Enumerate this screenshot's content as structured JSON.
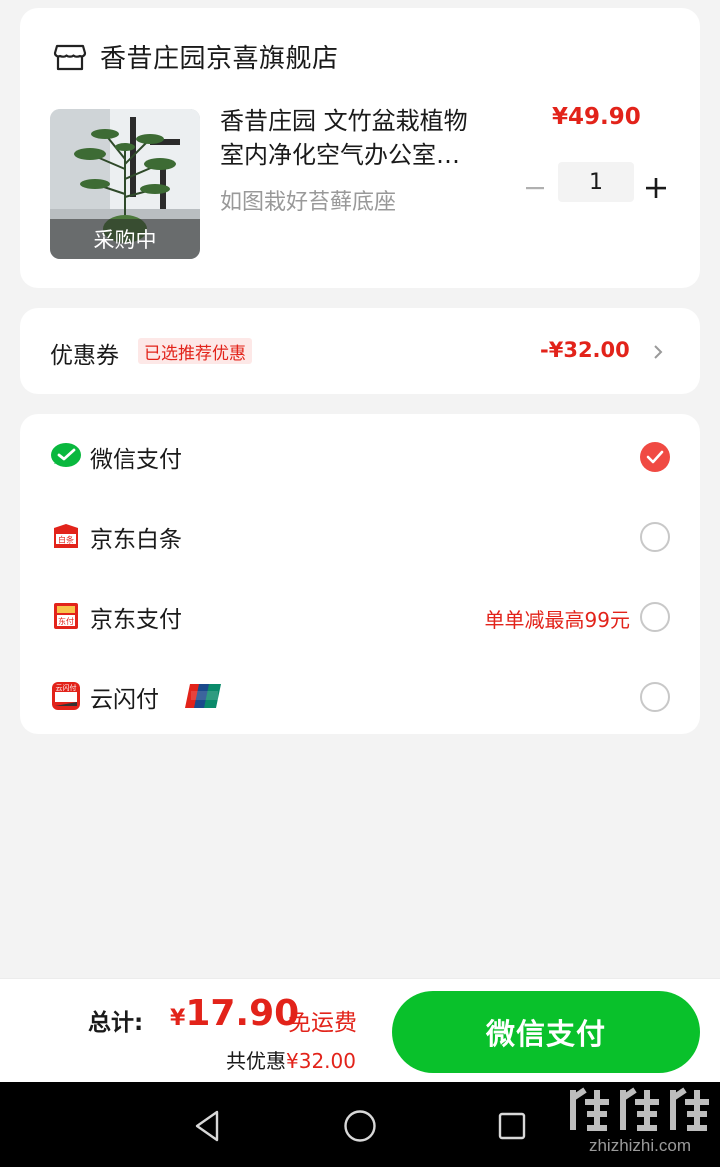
{
  "store": {
    "name": "香昔庄园京喜旗舰店"
  },
  "product": {
    "thumb_status": "采购中",
    "title_line1": "香昔庄园 文竹盆栽植物",
    "title_line2": "室内净化空气办公室…",
    "spec": "如图栽好苔藓底座",
    "price": "¥49.90",
    "quantity": "1"
  },
  "coupon": {
    "label": "优惠券",
    "tag": "已选推荐优惠",
    "amount": "-¥32.00"
  },
  "payment_methods": [
    {
      "label": "微信支付",
      "icon": "wechat-pay-icon",
      "selected": true,
      "note": ""
    },
    {
      "label": "京东白条",
      "icon": "jd-baitiao-icon",
      "selected": false,
      "note": ""
    },
    {
      "label": "京东支付",
      "icon": "jd-pay-icon",
      "selected": false,
      "note": "单单减最高99元"
    },
    {
      "label": "云闪付",
      "icon": "quickpass-icon",
      "selected": false,
      "note": ""
    }
  ],
  "footer": {
    "total_label": "总计:",
    "total_yen": "¥",
    "total_value": "17.90",
    "free_shipping": "免运费",
    "saving_prefix": "共优惠",
    "saving_amount": "¥32.00",
    "pay_button": "微信支付"
  },
  "watermark": {
    "text": "zhizhizhi.com"
  },
  "colors": {
    "accent_red": "#e2231a",
    "wechat_green": "#09c12b",
    "radio_checked": "#f04a43"
  }
}
